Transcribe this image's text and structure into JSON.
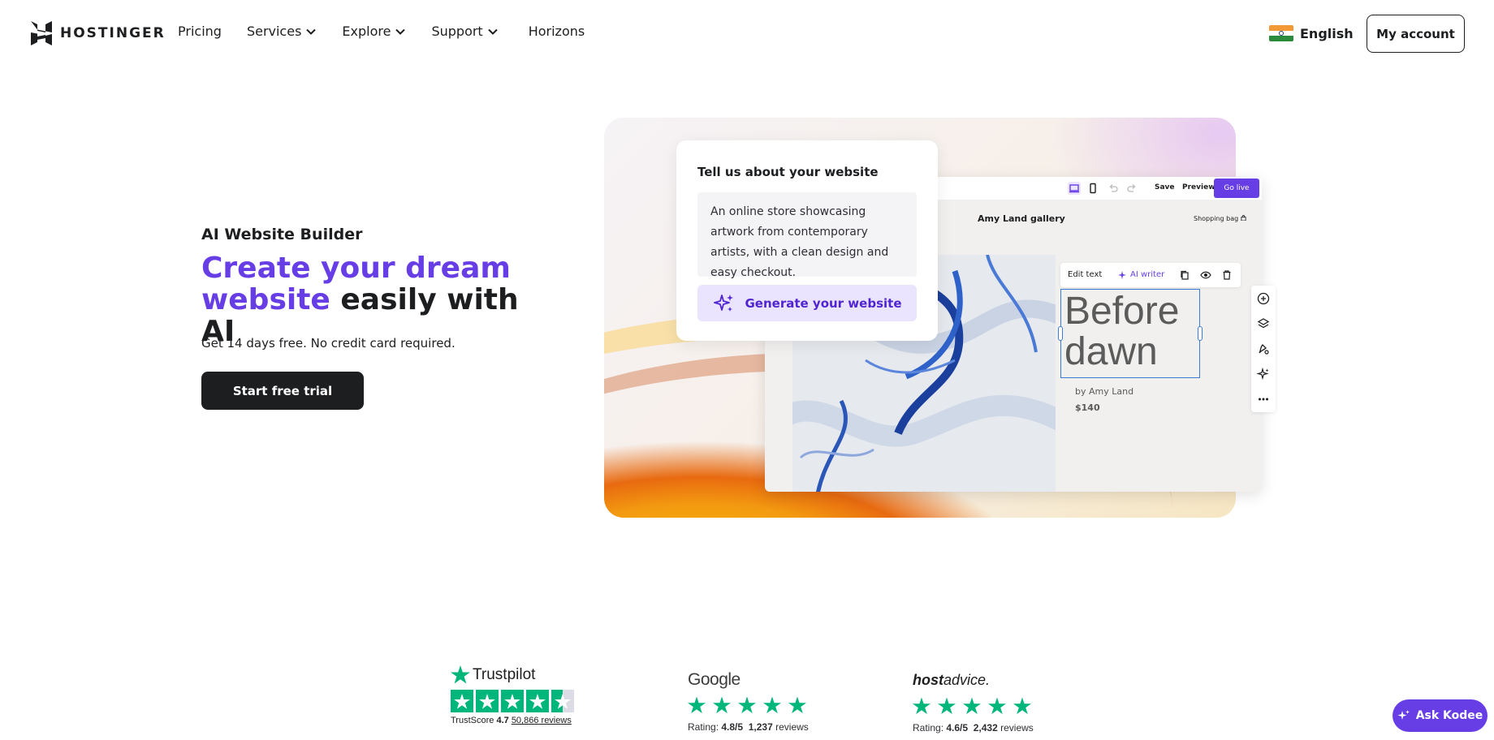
{
  "header": {
    "brand": "HOSTINGER",
    "nav": [
      {
        "label": "Pricing",
        "dropdown": false
      },
      {
        "label": "Services",
        "dropdown": true
      },
      {
        "label": "Explore",
        "dropdown": true
      },
      {
        "label": "Support",
        "dropdown": true
      },
      {
        "label": "Horizons",
        "dropdown": false
      }
    ],
    "language": "English",
    "account_label": "My account"
  },
  "hero": {
    "kicker": "AI Website Builder",
    "title_accent": "Create your dream website",
    "title_rest": "easily with AI",
    "subtitle": "Get 14 days free. No credit card required.",
    "cta": "Start free trial"
  },
  "prompt_card": {
    "title": "Tell us about your website",
    "text": "An online store showcasing artwork from contemporary artists, with a clean design and easy checkout.",
    "button": "Generate your website"
  },
  "editor": {
    "save": "Save",
    "preview": "Preview",
    "go_live": "Go live",
    "site_title": "Amy Land gallery",
    "shopping_bag": "Shopping bag",
    "edit_text": "Edit text",
    "ai_writer": "AI writer",
    "heading_line1": "Before",
    "heading_line2": "dawn",
    "byline": "by Amy Land",
    "price": "$140"
  },
  "ratings": {
    "trustpilot": {
      "brand": "Trustpilot",
      "score_label": "TrustScore",
      "score": "4.7",
      "reviews": "50,866",
      "reviews_label": "reviews"
    },
    "google": {
      "brand": "Google",
      "rating_label": "Rating:",
      "rating": "4.8/5",
      "reviews": "1,237",
      "reviews_label": "reviews"
    },
    "hostadvice": {
      "brand_a": "host",
      "brand_b": "advice.",
      "rating_label": "Rating:",
      "rating": "4.6/5",
      "reviews": "2,432",
      "reviews_label": "reviews"
    }
  },
  "chat": {
    "label": "Ask Kodee"
  },
  "colors": {
    "accent": "#673de6",
    "dark": "#1d1e20",
    "trust_green": "#00b67a"
  }
}
